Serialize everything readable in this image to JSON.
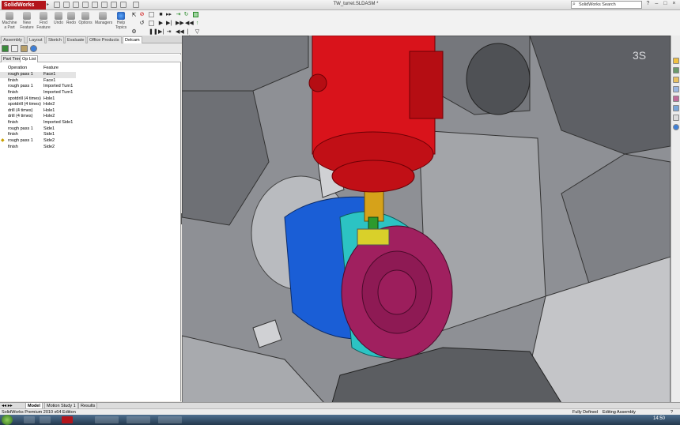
{
  "app": {
    "name": "SolidWorks",
    "doc_title": "TW_turret.SLDASM *"
  },
  "search": {
    "placeholder": "SolidWorks Search"
  },
  "window": {
    "help_label": "?",
    "minimize_label": "–",
    "maximize_label": "□",
    "close_label": "×"
  },
  "toolbar": {
    "machine_part": "Machine a Part",
    "new_feature": "New Feature",
    "find_feature": "Find Feature",
    "undo": "Undo",
    "redo": "Redo",
    "options": "Options",
    "managers": "Managers",
    "help_topics": "Help Topics"
  },
  "tabs": [
    "Assembly",
    "Layout",
    "Sketch",
    "Evaluate",
    "Office Products",
    "Delcam"
  ],
  "active_tab": "Delcam",
  "panel": {
    "subtabs": [
      "Part Tree",
      "Op List"
    ],
    "active_subtab": "Op List",
    "col_operation": "Operation",
    "col_feature": "Feature",
    "ops": [
      {
        "operation": "rough pass 1",
        "feature": "Face1"
      },
      {
        "operation": "finish",
        "feature": "Face1"
      },
      {
        "operation": "rough pass 1",
        "feature": "Imported Turn1"
      },
      {
        "operation": "finish",
        "feature": "Imported Turn1"
      },
      {
        "operation": "spotdrill (4 times)",
        "feature": "Hole1"
      },
      {
        "operation": "spotdrill (4 times)",
        "feature": "Hole2"
      },
      {
        "operation": "drill (4 times)",
        "feature": "Hole1"
      },
      {
        "operation": "drill (4 times)",
        "feature": "Hole2"
      },
      {
        "operation": "finish",
        "feature": "Imported Side1"
      },
      {
        "operation": "rough pass 1",
        "feature": "Side1"
      },
      {
        "operation": "finish",
        "feature": "Side1"
      },
      {
        "operation": "rough pass 1",
        "feature": "Side2"
      },
      {
        "operation": "finish",
        "feature": "Side2"
      }
    ]
  },
  "bottom_tabs": [
    "Model",
    "Motion Study 1",
    "Results"
  ],
  "active_bottom_tab": "Model",
  "status": {
    "edition": "SolidWorks Premium 2010 x64 Edition",
    "state": "Fully Defined",
    "mode": "Editing Assembly",
    "help": "?"
  },
  "taskbar": {
    "clock": "14:50"
  },
  "colors": {
    "spindle": "#d9131b",
    "part_blue": "#1a5ed6",
    "part_teal": "#2cc3c3",
    "part_magenta": "#a0205f",
    "tool_gold": "#d6a21a",
    "brand": "#b3151b"
  },
  "icons": [
    "search-icon",
    "undo-icon",
    "redo-icon",
    "options-icon",
    "managers-icon",
    "help-icon",
    "play-icon",
    "stop-icon"
  ]
}
